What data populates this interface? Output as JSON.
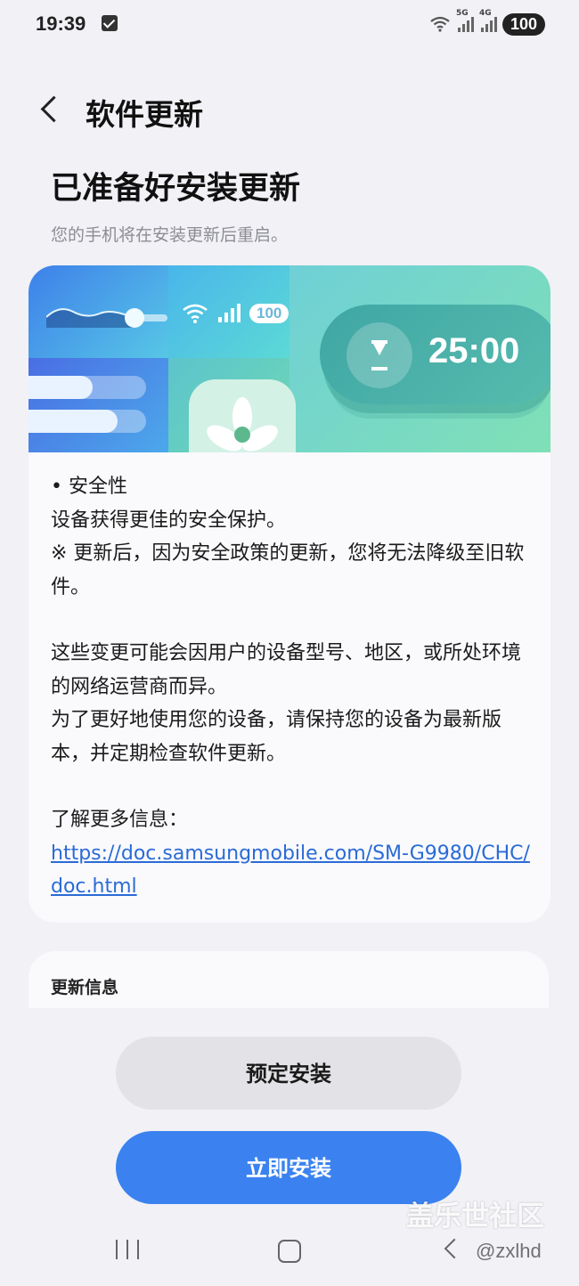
{
  "status": {
    "time": "19:39",
    "signal_a": "5G",
    "signal_b": "4G",
    "battery": "100"
  },
  "header": {
    "title": "软件更新",
    "headline": "已准备好安装更新",
    "subtitle": "您的手机将在安装更新后重启。"
  },
  "banner": {
    "battery": "100",
    "timer": "25:00"
  },
  "card": {
    "security_heading": "• 安全性",
    "security_line1": "设备获得更佳的安全保护。",
    "security_line2": "※ 更新后，因为安全政策的更新，您将无法降级至旧软件。",
    "para2": "这些变更可能会因用户的设备型号、地区，或所处环境的网络运营商而异。",
    "para3": "为了更好地使用您的设备，请保持您的设备为最新版本，并定期检查软件更新。",
    "more_info_label": "了解更多信息：",
    "more_info_url": "https://doc.samsungmobile.com/SM-G9980/CHC/doc.html"
  },
  "info_section": {
    "label": "更新信息"
  },
  "buttons": {
    "schedule": "预定安装",
    "install_now": "立即安装"
  },
  "watermark": {
    "title": "盖乐世社区",
    "handle": "@zxlhd"
  },
  "colors": {
    "accent": "#3b82f0",
    "link": "#2a6bd6",
    "background": "#f1f1f6"
  }
}
